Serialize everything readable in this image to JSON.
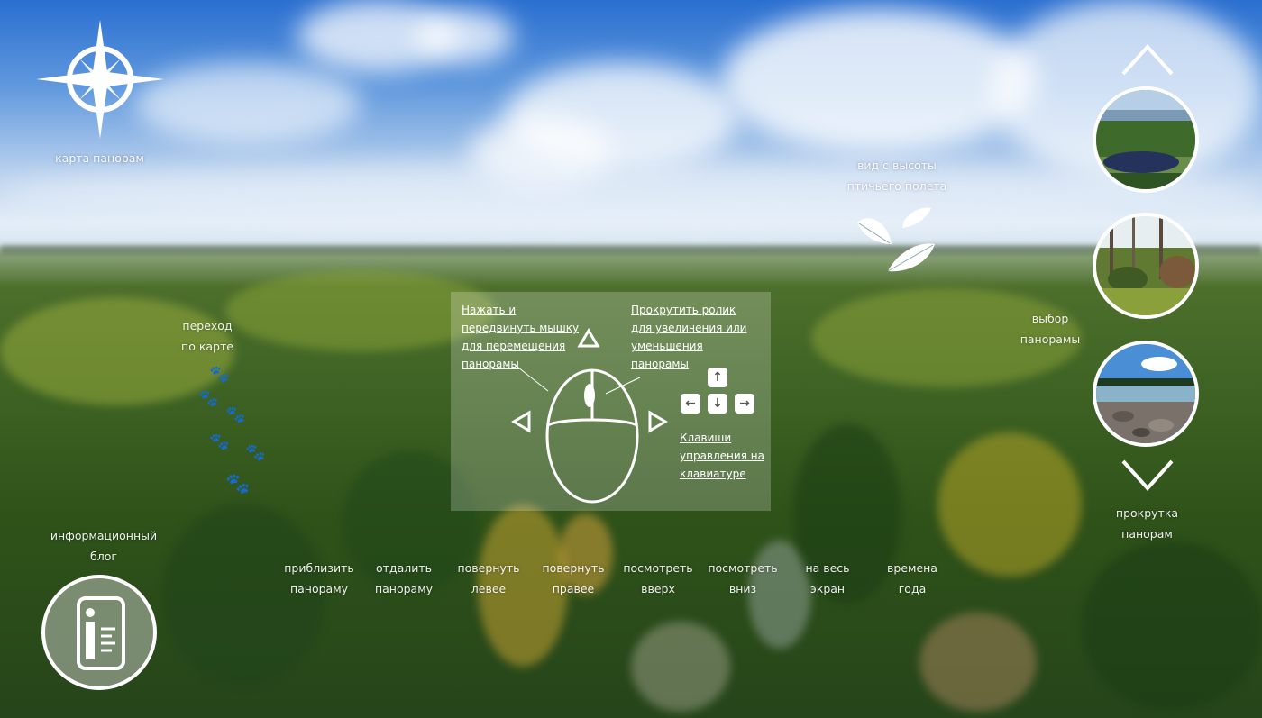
{
  "compass": {
    "label": "карта панорам",
    "icon": "compass-rose-icon"
  },
  "bird_view": {
    "line1": "вид с высоты",
    "line2": "птичьего полета",
    "icon": "feathers-icon"
  },
  "map_walk": {
    "line1": "переход",
    "line2": "по карте",
    "icon": "paw-prints-icon"
  },
  "panorama_select": {
    "line1": "выбор",
    "line2": "панорамы"
  },
  "scroll_panoramas": {
    "line1": "прокрутка",
    "line2": "панорам"
  },
  "info_blog": {
    "line1": "информационный",
    "line2": "блог",
    "icon": "info-icon"
  },
  "help": {
    "mouse_drag": [
      "Нажать и",
      "передвинуть мышку",
      "для перемещения",
      "панорамы"
    ],
    "scroll_wheel": [
      "Прокрутить ролик",
      "для увеличения или",
      "уменьшения",
      "панорамы"
    ],
    "keyboard": [
      "Клавиши",
      "управления на",
      "клавиатуре"
    ],
    "keys": {
      "up": "↑",
      "down": "↓",
      "left": "←",
      "right": "→"
    }
  },
  "toolbar": [
    {
      "l1": "приблизить",
      "l2": "панораму"
    },
    {
      "l1": "отдалить",
      "l2": "панораму"
    },
    {
      "l1": "повернуть",
      "l2": "левее"
    },
    {
      "l1": "повернуть",
      "l2": "правее"
    },
    {
      "l1": "посмотреть",
      "l2": "вверх"
    },
    {
      "l1": "посмотреть",
      "l2": "вниз"
    },
    {
      "l1": "на весь",
      "l2": "экран"
    },
    {
      "l1": "времена",
      "l2": "года"
    }
  ]
}
